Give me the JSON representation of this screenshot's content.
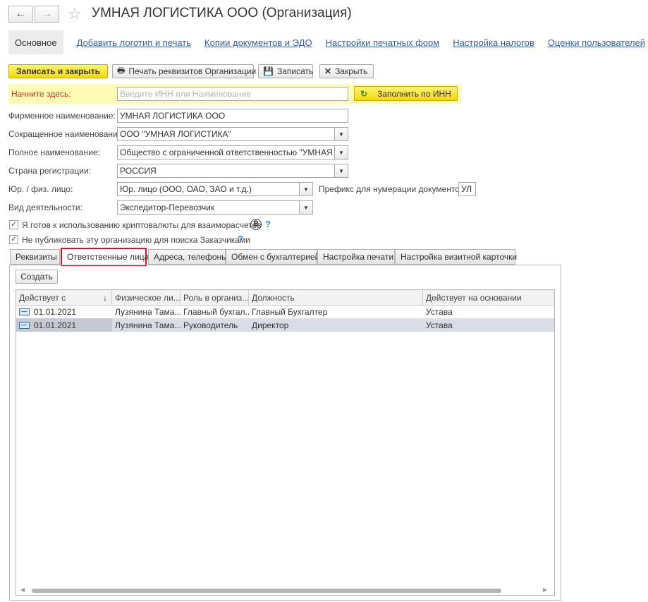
{
  "window": {
    "title": "УМНАЯ ЛОГИСТИКА ООО (Организация)"
  },
  "topnav": {
    "active": "Основное",
    "links": [
      "Добавить логотип и печать",
      "Копии документов и ЭДО",
      "Настройки печатных форм",
      "Настройка налогов",
      "Оценки пользователей"
    ]
  },
  "toolbar": {
    "save_close": "Записать и закрыть",
    "print_details": "Печать реквизитов Организации",
    "save": "Записать",
    "close": "Закрыть"
  },
  "quickfill": {
    "label": "Начните здесь:",
    "placeholder": "Введите ИНН или Наименование",
    "fill_button": "Заполнить по ИНН"
  },
  "form": {
    "firm_name_label": "Фирменное наименование:",
    "firm_name_value": "УМНАЯ ЛОГИСТИКА ООО",
    "short_name_label": "Сокращенное наименование:",
    "short_name_value": "ООО \"УМНАЯ ЛОГИСТИКА\"",
    "full_name_label": "Полное наименование:",
    "full_name_value": "Общество с ограниченной ответственностью \"УМНАЯ ЛОГ",
    "country_label": "Страна регистрации:",
    "country_value": "РОССИЯ",
    "entity_type_label": "Юр. / физ. лицо:",
    "entity_type_value": "Юр. лицо (ООО, ОАО, ЗАО и т.д.)",
    "prefix_label": "Префикс для нумерации документов :",
    "prefix_value": "УЛ",
    "activity_label": "Вид деятельности:",
    "activity_value": "Экспедитор-Перевозчик",
    "crypto_label": "Я готов к использованию криптовалюты для взаиморасчетов",
    "crypto_checked": true,
    "hide_label": "Не публиковать эту организацию для поиска Заказчиками",
    "hide_checked": true,
    "help_mark": "?",
    "crypto_symbol": "₿"
  },
  "tabs": [
    "Реквизиты",
    "Ответственные лица",
    "Адреса, телефоны",
    "Обмен с бухгалтерией",
    "Настройка печати",
    "Настройка визитной карточки"
  ],
  "active_tab": "Ответственные лица",
  "panel": {
    "create_button": "Создать"
  },
  "table": {
    "columns": [
      "Действует с",
      "Физическое ли...",
      "Роль в организ...",
      "Должность",
      "Действует на основании"
    ],
    "sort_indicator": "↓",
    "rows": [
      [
        "01.01.2021",
        "Лузянина Тама...",
        "Главный бухгал...",
        "Главный Бухгалтер",
        "Устава"
      ],
      [
        "01.01.2021",
        "Лузянина Тама...",
        "Руководитель",
        "Директор",
        "Устава"
      ]
    ],
    "selected_row": 1
  },
  "colors": {
    "primary_button": "#f5d90a",
    "quickfill_bg": "#fdfbb4",
    "link": "#3a5e9c",
    "active_tab_outline": "#d8102a",
    "selected_row": "#d8dde6"
  }
}
